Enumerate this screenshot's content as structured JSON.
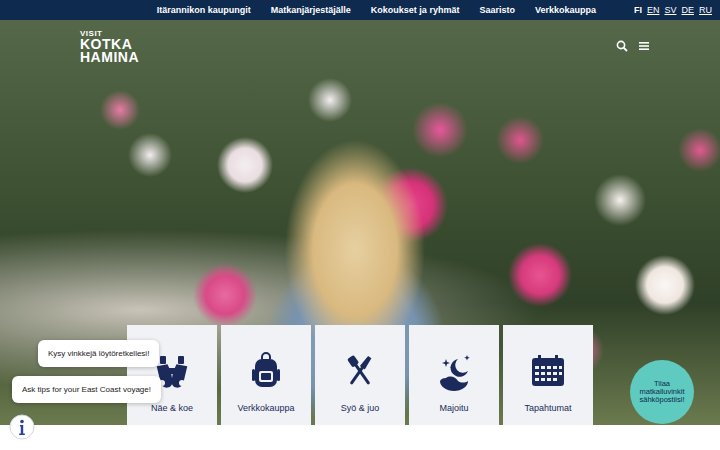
{
  "top_nav": {
    "links": [
      "Itärannikon kaupungit",
      "Matkanjärjestäjälle",
      "Kokoukset ja ryhmät",
      "Saaristo",
      "Verkkokauppa"
    ],
    "languages": [
      {
        "label": "FI",
        "selected": true
      },
      {
        "label": "EN",
        "selected": false
      },
      {
        "label": "SV",
        "selected": false
      },
      {
        "label": "DE",
        "selected": false
      },
      {
        "label": "RU",
        "selected": false
      }
    ]
  },
  "logo": {
    "lines": [
      "VISIT",
      "KOTKA",
      "HAMINA"
    ]
  },
  "cards": [
    {
      "label": "Näe & koe"
    },
    {
      "label": "Verkkokauppa"
    },
    {
      "label": "Syö & juo"
    },
    {
      "label": "Majoitu"
    },
    {
      "label": "Tapahtumat"
    }
  ],
  "chat": {
    "bubbles": [
      "Kysy vinkkejä löytöretkellesi!",
      "Ask tips for your East Coast voyage!"
    ]
  },
  "newsletter": {
    "label": "Tilaa matkailuvinkit sähköpostiisi!"
  }
}
